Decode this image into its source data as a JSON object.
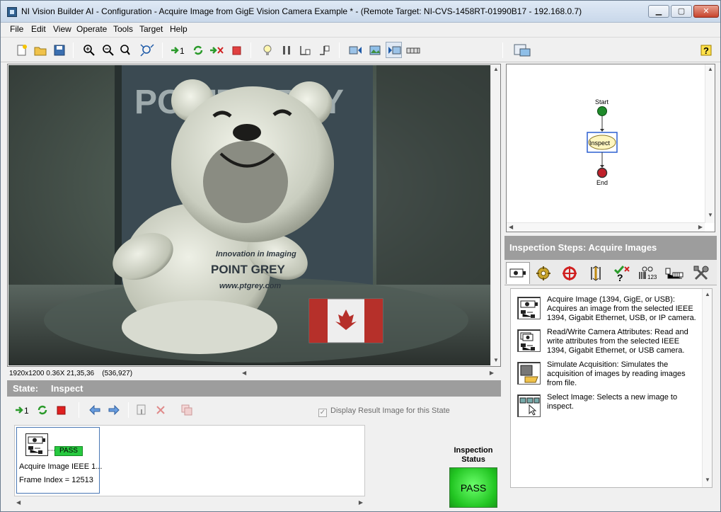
{
  "window": {
    "title": "NI Vision Builder AI - Configuration - Acquire Image from GigE Vision Camera Example * - (Remote Target: NI-CVS-1458RT-01990B17 - 192.168.0.7)"
  },
  "menu": [
    "File",
    "Edit",
    "View",
    "Operate",
    "Tools",
    "Target",
    "Help"
  ],
  "toolbar": {
    "zoom_fit_label": "1:1",
    "run_once_label": "1"
  },
  "photo": {
    "brand_banner": "POINT GREY",
    "shirt_line1": "Innovation in Imaging",
    "shirt_line2": "POINT GREY",
    "shirt_line3": "www.ptgrey.com"
  },
  "viewer": {
    "status_info": "1920x1200 0.36X 21,35,36",
    "coords": "(536,927)"
  },
  "state": {
    "label": "State:",
    "name": "Inspect",
    "display_result_checkbox": "Display Result Image for this State",
    "display_result_checked": true
  },
  "step_card": {
    "status": "PASS",
    "name": "Acquire Image IEEE 1...",
    "frame_info": "Frame Index = 12513"
  },
  "inspection_status": {
    "label": "Inspection Status",
    "value": "PASS"
  },
  "flow": {
    "start": "Start",
    "inspect": "Inspect",
    "end": "End"
  },
  "inspection_steps": {
    "header": "Inspection Steps: Acquire Images",
    "tabs": [
      "acquire-images",
      "enhance-images",
      "locate-features",
      "measure-features",
      "check-for-presence",
      "identify-parts",
      "use-additional-tools",
      "communicate"
    ],
    "items": [
      {
        "title": "Acquire Image (1394, GigE, or USB):",
        "desc": "Acquires an image from the selected IEEE 1394, Gigabit Ethernet, USB, or IP camera."
      },
      {
        "title": "Read/Write Camera Attributes:",
        "desc": "Read and write attributes from the selected IEEE 1394, Gigabit Ethernet, or USB camera."
      },
      {
        "title": "Simulate Acquisition:",
        "desc": "Simulates the acquisition of images by reading images from file."
      },
      {
        "title": "Select Image:",
        "desc": "Selects a new image to inspect."
      }
    ]
  },
  "colors": {
    "pass_green": "#27c93f",
    "header_gray": "#9d9d9d",
    "flow_start": "#1f8a2a",
    "flow_end": "#c0202a"
  }
}
